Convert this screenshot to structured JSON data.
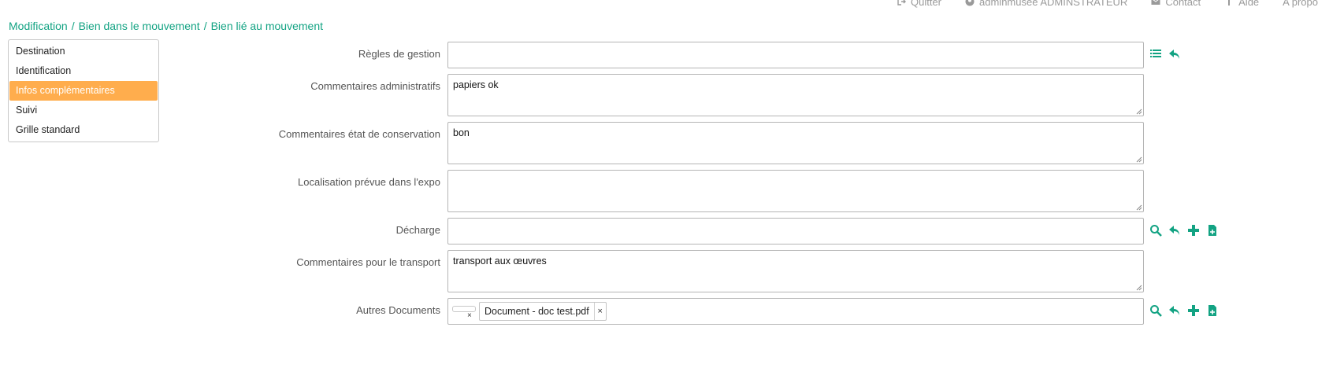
{
  "topbar": {
    "quit": "Quitter",
    "user": "adminmusee ADMINSTRATEUR",
    "contact": "Contact",
    "help": "Aide",
    "about": "A propo"
  },
  "breadcrumb": {
    "items": [
      "Modification",
      "Bien dans le mouvement",
      "Bien lié au mouvement"
    ],
    "separator": "/"
  },
  "sidebar": {
    "items": [
      {
        "label": "Destination"
      },
      {
        "label": "Identification"
      },
      {
        "label": "Infos complémentaires",
        "active": true
      },
      {
        "label": "Suivi"
      },
      {
        "label": "Grille standard"
      }
    ]
  },
  "form": {
    "regles": {
      "label": "Règles de gestion",
      "value": ""
    },
    "comm_admin": {
      "label": "Commentaires administratifs",
      "value": "papiers ok"
    },
    "comm_etat": {
      "label": "Commentaires état de conservation",
      "value": "bon"
    },
    "localisation": {
      "label": "Localisation prévue dans l'expo",
      "value": ""
    },
    "decharge": {
      "label": "Décharge",
      "value": ""
    },
    "comm_transport": {
      "label": "Commentaires pour le transport",
      "value": "transport aux œuvres"
    },
    "autres_docs": {
      "label": "Autres Documents",
      "tag": "Document - doc test.pdf",
      "remove": "×"
    }
  },
  "colors": {
    "accent": "#13a383",
    "active_tab": "#ffad4d"
  },
  "icons": [
    "list-icon",
    "undo-icon",
    "search-icon",
    "plus-icon",
    "new-file-icon"
  ]
}
